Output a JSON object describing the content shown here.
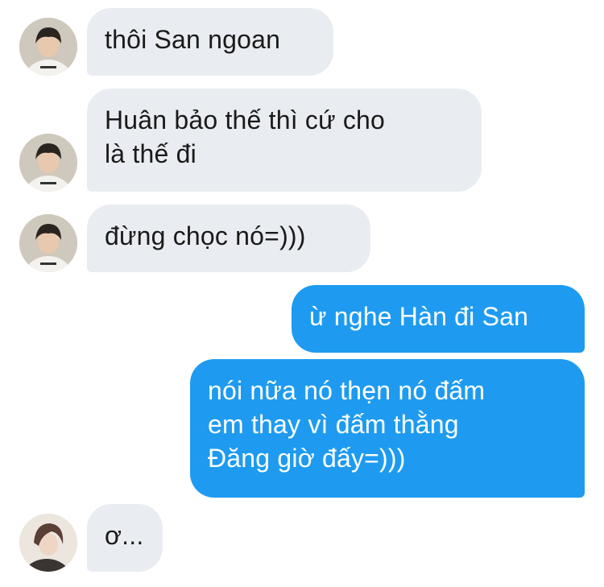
{
  "colors": {
    "incoming_bubble": "#e9ecf0",
    "outgoing_bubble": "#1e9bf0",
    "incoming_text": "#1a1a1a",
    "outgoing_text": "#ffffff"
  },
  "messages": [
    {
      "sender": "other",
      "avatar": "user-a-avatar",
      "text": "thôi San ngoan"
    },
    {
      "sender": "other",
      "avatar": "user-a-avatar",
      "text": "Huân bảo thế thì cứ cho\nlà thế đi"
    },
    {
      "sender": "other",
      "avatar": "user-a-avatar",
      "text": "đừng chọc nó=)))"
    },
    {
      "sender": "me",
      "text": "ừ nghe Hàn đi San"
    },
    {
      "sender": "me",
      "text": "nói nữa nó thẹn nó đấm\nem thay vì đấm thằng\nĐăng giờ đấy=)))"
    },
    {
      "sender": "other",
      "avatar": "user-b-avatar",
      "text": "ơ..."
    }
  ]
}
